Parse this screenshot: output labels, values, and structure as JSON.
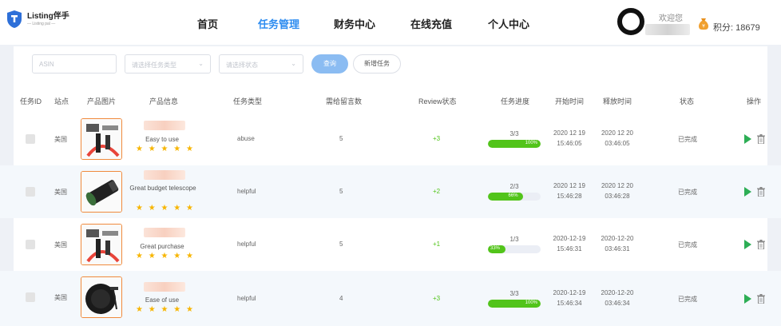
{
  "header": {
    "logo_name": "Listing伴手",
    "logo_sub": "— Listing pal —",
    "nav": [
      "首页",
      "任务管理",
      "财务中心",
      "在线充值",
      "个人中心"
    ],
    "active_nav": "任务管理",
    "welcome": "欢迎您",
    "points_label": "积分: 18679"
  },
  "filters": {
    "asin_placeholder": "ASIN",
    "type_placeholder": "请选择任务类型",
    "status_placeholder": "请选择状态",
    "search_label": "查询",
    "new_task_label": "新增任务"
  },
  "table": {
    "headers": [
      "任务ID",
      "站点",
      "产品图片",
      "产品信息",
      "任务类型",
      "需给留言数",
      "Review状态",
      "任务进度",
      "开始时间",
      "释放时间",
      "状态",
      "操作"
    ],
    "rows": [
      {
        "site": "美国",
        "product": "Easy to use",
        "stars": "★ ★ ★ ★ ★",
        "type": "abuse",
        "count": "5",
        "review": "+3",
        "progress_text": "3/3",
        "progress": 1.0,
        "progress_pct": "100%",
        "start_date": "2020 12 19",
        "start_time": "15:46:05",
        "release_date": "2020 12 20",
        "release_time": "03:46:05",
        "status": "已完成"
      },
      {
        "site": "美国",
        "product": "Great budget telescope",
        "stars": "★ ★ ★ ★ ★",
        "type": "helpful",
        "count": "5",
        "review": "+2",
        "progress_text": "2/3",
        "progress": 0.66,
        "progress_pct": "66%",
        "start_date": "2020 12 19",
        "start_time": "15:46:28",
        "release_date": "2020 12 20",
        "release_time": "03:46:28",
        "status": "已完成"
      },
      {
        "site": "美国",
        "product": "Great purchase",
        "stars": "★ ★ ★ ★ ★",
        "type": "helpful",
        "count": "5",
        "review": "+1",
        "progress_text": "1/3",
        "progress": 0.33,
        "progress_pct": "33%",
        "start_date": "2020-12-19",
        "start_time": "15:46:31",
        "release_date": "2020-12-20",
        "release_time": "03:46:31",
        "status": "已完成"
      },
      {
        "site": "美国",
        "product": "Ease of use",
        "stars": "★ ★ ★ ★ ★",
        "type": "helpful",
        "count": "4",
        "review": "+3",
        "progress_text": "3/3",
        "progress": 1.0,
        "progress_pct": "100%",
        "start_date": "2020-12-19",
        "start_time": "15:46:34",
        "release_date": "2020-12-20",
        "release_time": "03:46:34",
        "status": "已完成"
      }
    ]
  },
  "colors": {
    "accent": "#2d8cf0",
    "success": "#52c41a",
    "star": "#f7b500",
    "thumb_border": "#f08a3c"
  },
  "icons": [
    "logo-shield-icon",
    "avatar-icon",
    "money-bag-icon",
    "chevron-down-icon",
    "play-icon",
    "trash-icon"
  ]
}
